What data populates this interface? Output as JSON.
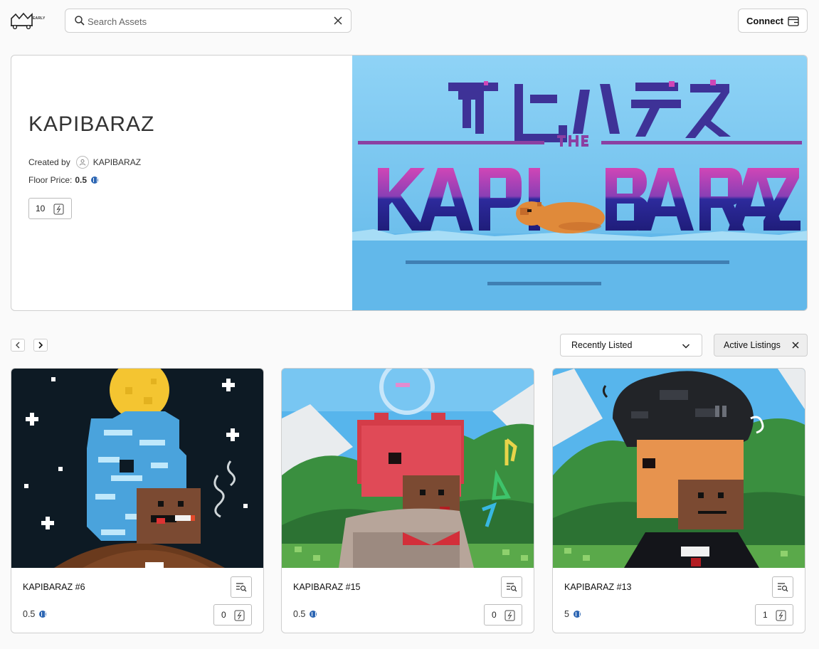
{
  "header": {
    "logo_tag": "EARLY",
    "search": {
      "placeholder": "Search Assets",
      "value": ""
    },
    "connect_label": "Connect"
  },
  "collection": {
    "title": "KAPIBARAZ",
    "created_by_label": "Created by",
    "creator": "KAPIBARAZ",
    "floor_label": "Floor Price:",
    "floor_value": "0.5",
    "quantity": "10"
  },
  "controls": {
    "sort_selected": "Recently Listed",
    "filter_chip": "Active Listings"
  },
  "cards": [
    {
      "name": "KAPIBARAZ #6",
      "price": "0.5",
      "quantity": "0"
    },
    {
      "name": "KAPIBARAZ #15",
      "price": "0.5",
      "quantity": "0"
    },
    {
      "name": "KAPIBARAZ #13",
      "price": "5",
      "quantity": "1"
    }
  ],
  "colors": {
    "accent_blue": "#2d66b3",
    "border": "#cfcfcf",
    "banner_sky": "#6ec3ec"
  }
}
